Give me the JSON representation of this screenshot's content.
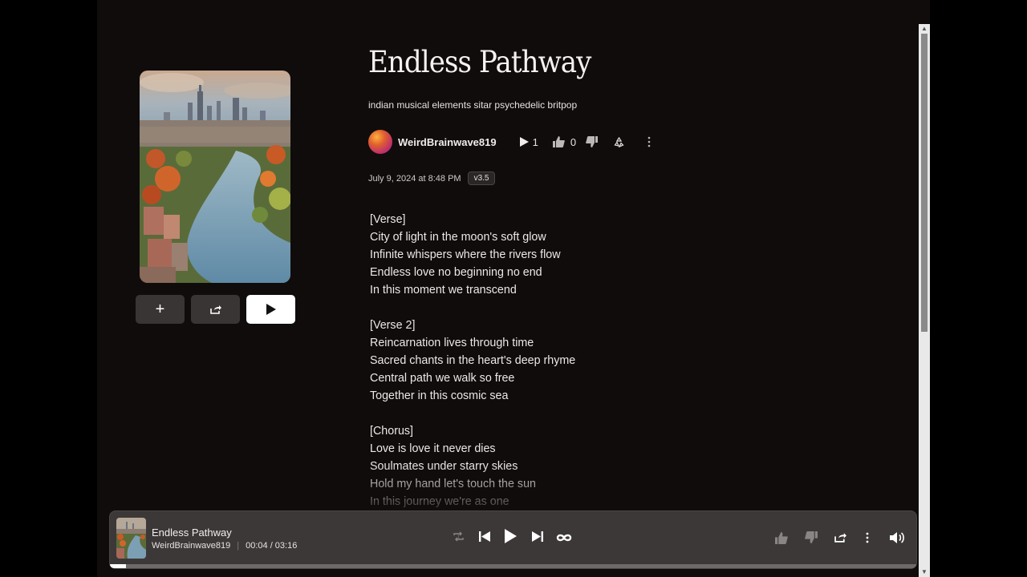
{
  "song": {
    "title": "Endless Pathway",
    "tags": "indian musical elements sitar psychedelic britpop",
    "author": "WeirdBrainwave819",
    "plays": "1",
    "likes": "0",
    "date": "July 9, 2024 at 8:48 PM",
    "version": "v3.5"
  },
  "lyrics": [
    "[Verse]",
    "City of light in the moon's soft glow",
    "Infinite whispers where the rivers flow",
    "Endless love no beginning no end",
    "In this moment we transcend",
    "",
    "[Verse 2]",
    "Reincarnation lives through time",
    "Sacred chants in the heart's deep rhyme",
    "Central path we walk so free",
    "Together in this cosmic sea",
    "",
    "[Chorus]",
    "Love is love it never dies",
    "Soulmates under starry skies",
    "Hold my hand let's touch the sun",
    "In this journey we're as one"
  ],
  "player": {
    "title": "Endless Pathway",
    "author": "WeirdBrainwave819",
    "time": "00:04 / 03:16",
    "progress_fraction": 0.02
  },
  "icons": {
    "add": "plus-icon",
    "share": "share-icon",
    "play": "play-icon",
    "like": "thumbs-up-icon",
    "dislike": "thumbs-down-icon",
    "remix": "recycle-icon",
    "more": "more-vertical-icon",
    "repeat": "repeat-icon",
    "prev": "skip-previous-icon",
    "next": "skip-next-icon",
    "loop": "infinity-icon",
    "volume": "volume-icon"
  },
  "colors": {
    "background": "#100c0c",
    "player_bg": "#3c3838",
    "button_bg": "#3a3535"
  }
}
